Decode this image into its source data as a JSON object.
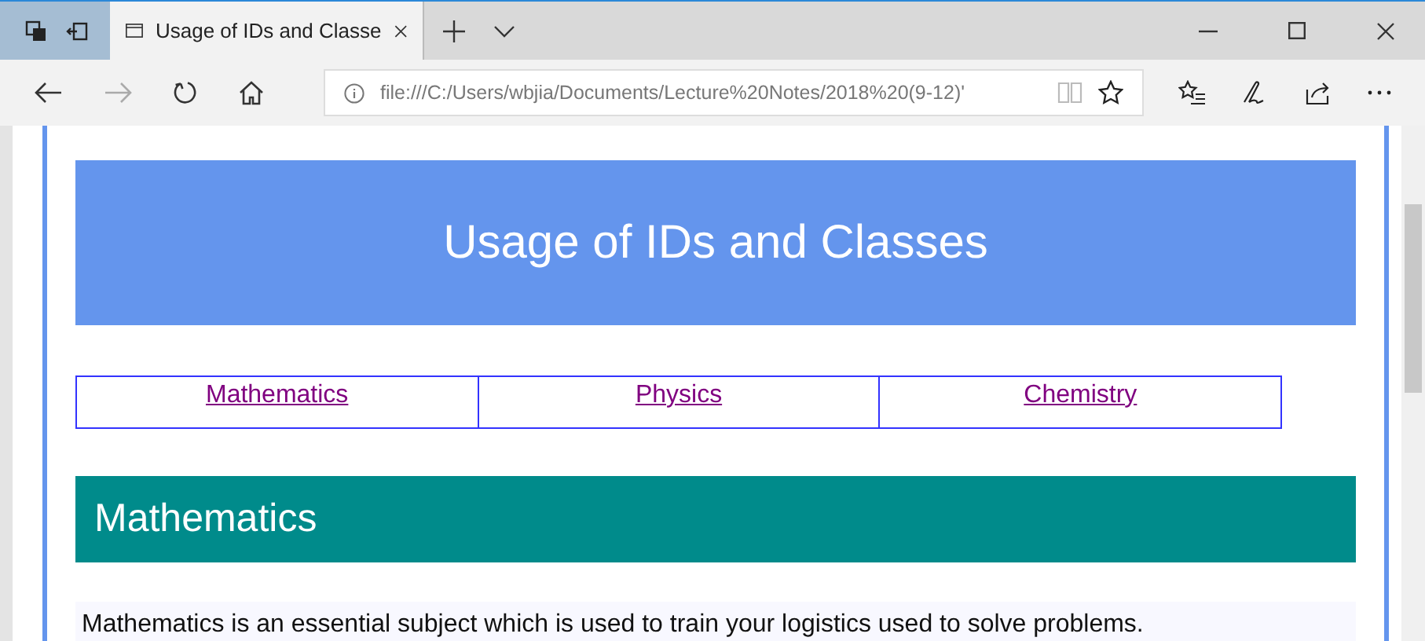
{
  "tabs": [
    {
      "title": "Usage of IDs and Classe",
      "selected": true
    }
  ],
  "nav_buttons": [
    {
      "kind": "back",
      "disabled": false
    },
    {
      "kind": "forward",
      "disabled": true
    },
    {
      "kind": "refresh",
      "disabled": false
    },
    {
      "kind": "home",
      "disabled": false
    }
  ],
  "address_bar": {
    "value": "file:///C:/Users/wbjia/Documents/Lecture%20Notes/2018%20(9-12)'"
  },
  "page": {
    "title": "Usage of IDs and Classes",
    "nav_links": [
      "Mathematics",
      "Physics",
      "Chemistry"
    ],
    "section": {
      "heading": "Mathematics",
      "paragraph": "Mathematics is an essential subject which is used to train your logistics used to solve problems."
    }
  }
}
